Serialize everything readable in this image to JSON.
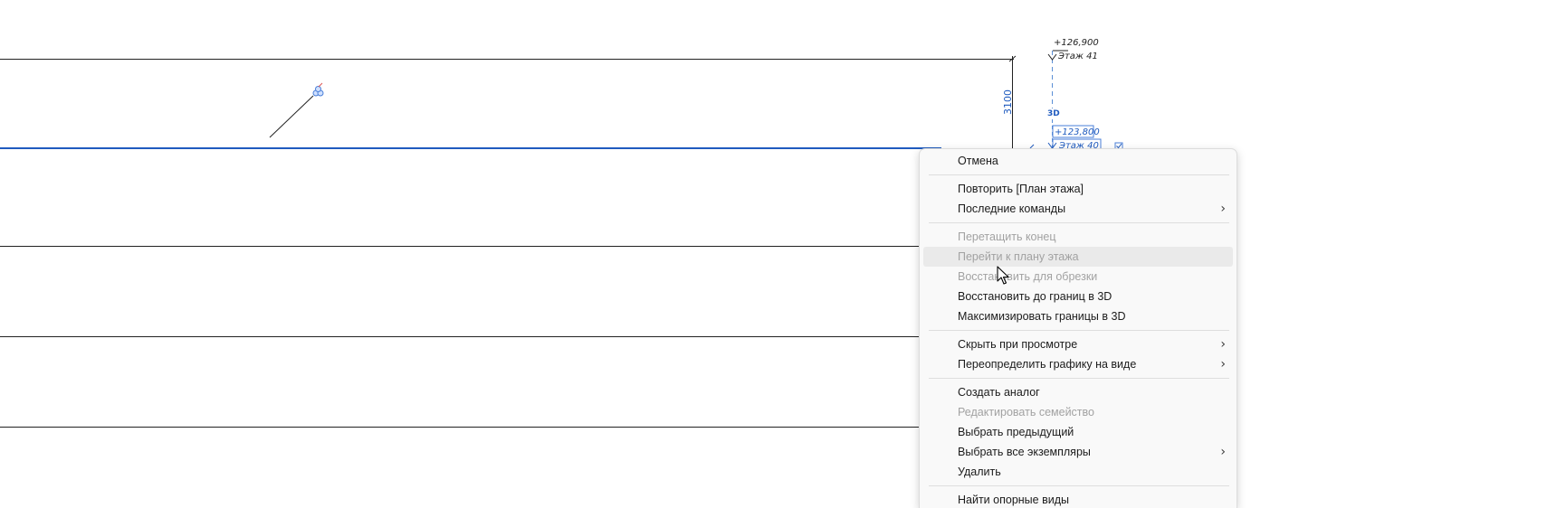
{
  "drawing": {
    "levels": [
      {
        "elevation": "+126,900",
        "name": "Этаж 41",
        "selected": false
      },
      {
        "elevation": "+123,800",
        "name": "Этаж 40",
        "selected": true
      }
    ],
    "dimension": "3100",
    "view_tag": "3D",
    "colors": {
      "line": "#222222",
      "selected": "#1f5bbf",
      "grip": "#4a7fd8"
    }
  },
  "context_menu": {
    "items": [
      {
        "label": "Отмена",
        "enabled": true
      },
      {
        "separator": true
      },
      {
        "label": "Повторить [План этажа]",
        "enabled": true
      },
      {
        "label": "Последние команды",
        "enabled": true,
        "submenu": true
      },
      {
        "separator": true
      },
      {
        "label": "Перетащить конец",
        "enabled": false
      },
      {
        "label": "Перейти к плану этажа",
        "enabled": false,
        "hover": true
      },
      {
        "label": "Восстановить для обрезки",
        "enabled": false
      },
      {
        "label": "Восстановить до границ в 3D",
        "enabled": true
      },
      {
        "label": "Максимизировать границы в 3D",
        "enabled": true
      },
      {
        "separator": true
      },
      {
        "label": "Скрыть при просмотре",
        "enabled": true,
        "submenu": true
      },
      {
        "label": "Переопределить графику на виде",
        "enabled": true,
        "submenu": true
      },
      {
        "separator": true
      },
      {
        "label": "Создать аналог",
        "enabled": true
      },
      {
        "label": "Редактировать семейство",
        "enabled": false
      },
      {
        "label": "Выбрать предыдущий",
        "enabled": true
      },
      {
        "label": "Выбрать все экземпляры",
        "enabled": true,
        "submenu": true
      },
      {
        "label": "Удалить",
        "enabled": true
      },
      {
        "separator": true
      },
      {
        "label": "Найти опорные виды",
        "enabled": true
      }
    ],
    "submenu_arrow": "›"
  }
}
